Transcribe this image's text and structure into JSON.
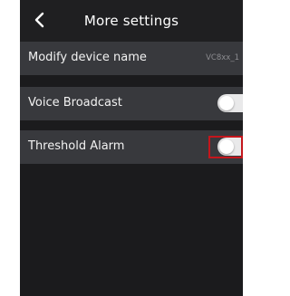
{
  "header": {
    "title": "More settings",
    "back_icon": "chevron-left-icon"
  },
  "settings": {
    "device_name": {
      "label": "Modify device name",
      "value": "VC8xx_1"
    },
    "voice_broadcast": {
      "label": "Voice Broadcast",
      "enabled": false
    },
    "threshold_alarm": {
      "label": "Threshold Alarm",
      "enabled": false,
      "highlighted": true
    }
  },
  "colors": {
    "background": "#1b1b1d",
    "row_background": "#38393d",
    "highlight": "#c4161c"
  }
}
